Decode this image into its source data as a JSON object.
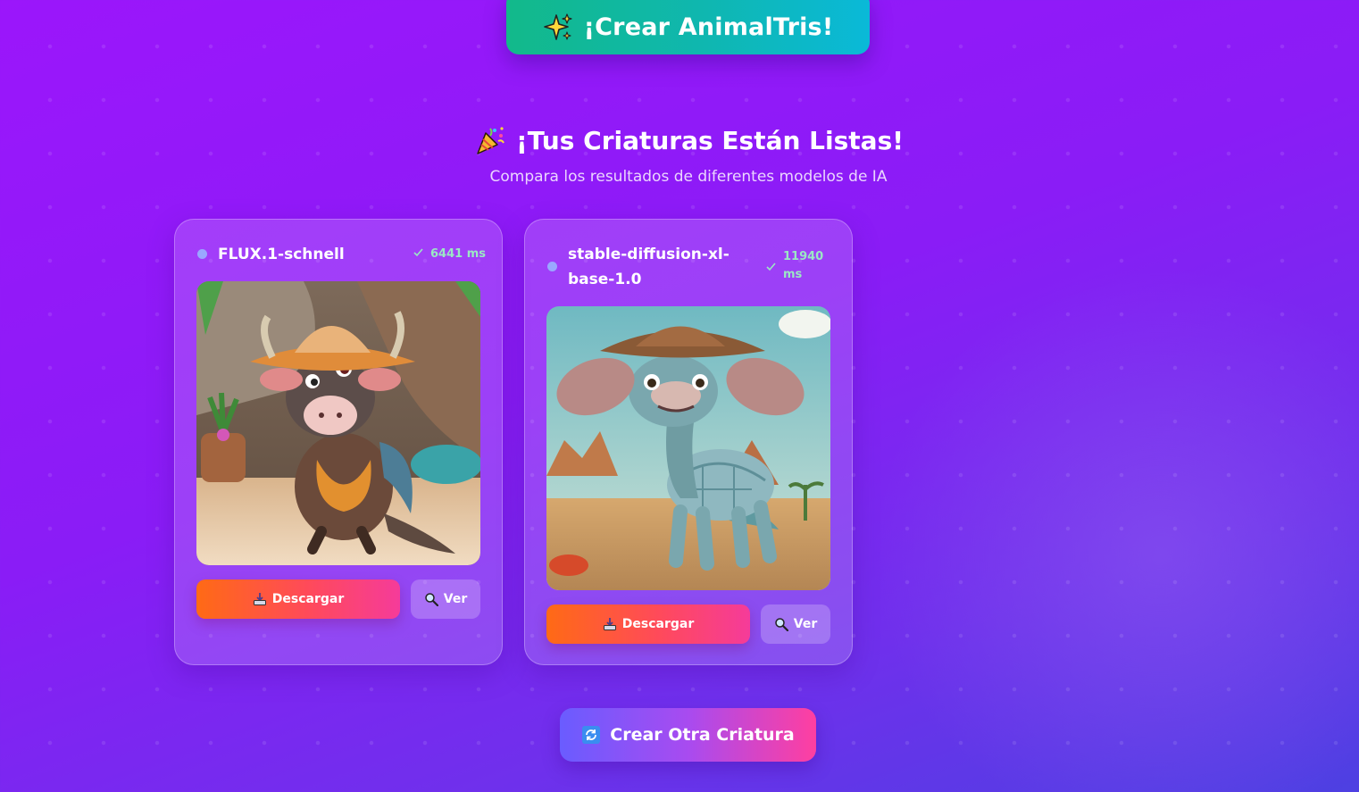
{
  "header": {
    "create_label": "¡Crear AnimalTris!",
    "create_icon": "sparkles-icon"
  },
  "results": {
    "title": "¡Tus Criaturas Están Listas!",
    "title_icon": "party-popper-icon",
    "subtitle": "Compara los resultados de diferentes modelos de IA"
  },
  "cards": [
    {
      "model": "FLUX.1-schnell",
      "timing": "6441 ms",
      "download_label": "Descargar",
      "view_label": "Ver",
      "image_alt": "bull-armadillo creature wearing sombrero"
    },
    {
      "model_line1": "stable-diffusion-xl-",
      "model_line2": "base-1.0",
      "timing_line1": "11940",
      "timing_line2": "ms",
      "download_label": "Descargar",
      "view_label": "Ver",
      "image_alt": "elephant-turtle creature wearing straw hat"
    }
  ],
  "footer": {
    "again_label": "Crear Otra Criatura",
    "again_icon": "refresh-icon"
  },
  "colors": {
    "background_start": "#9b16fb",
    "background_end": "#4d40e2",
    "create_button": "#0fb7b0",
    "download_button": "#ff6a15",
    "timing_text": "#9be7c4"
  }
}
